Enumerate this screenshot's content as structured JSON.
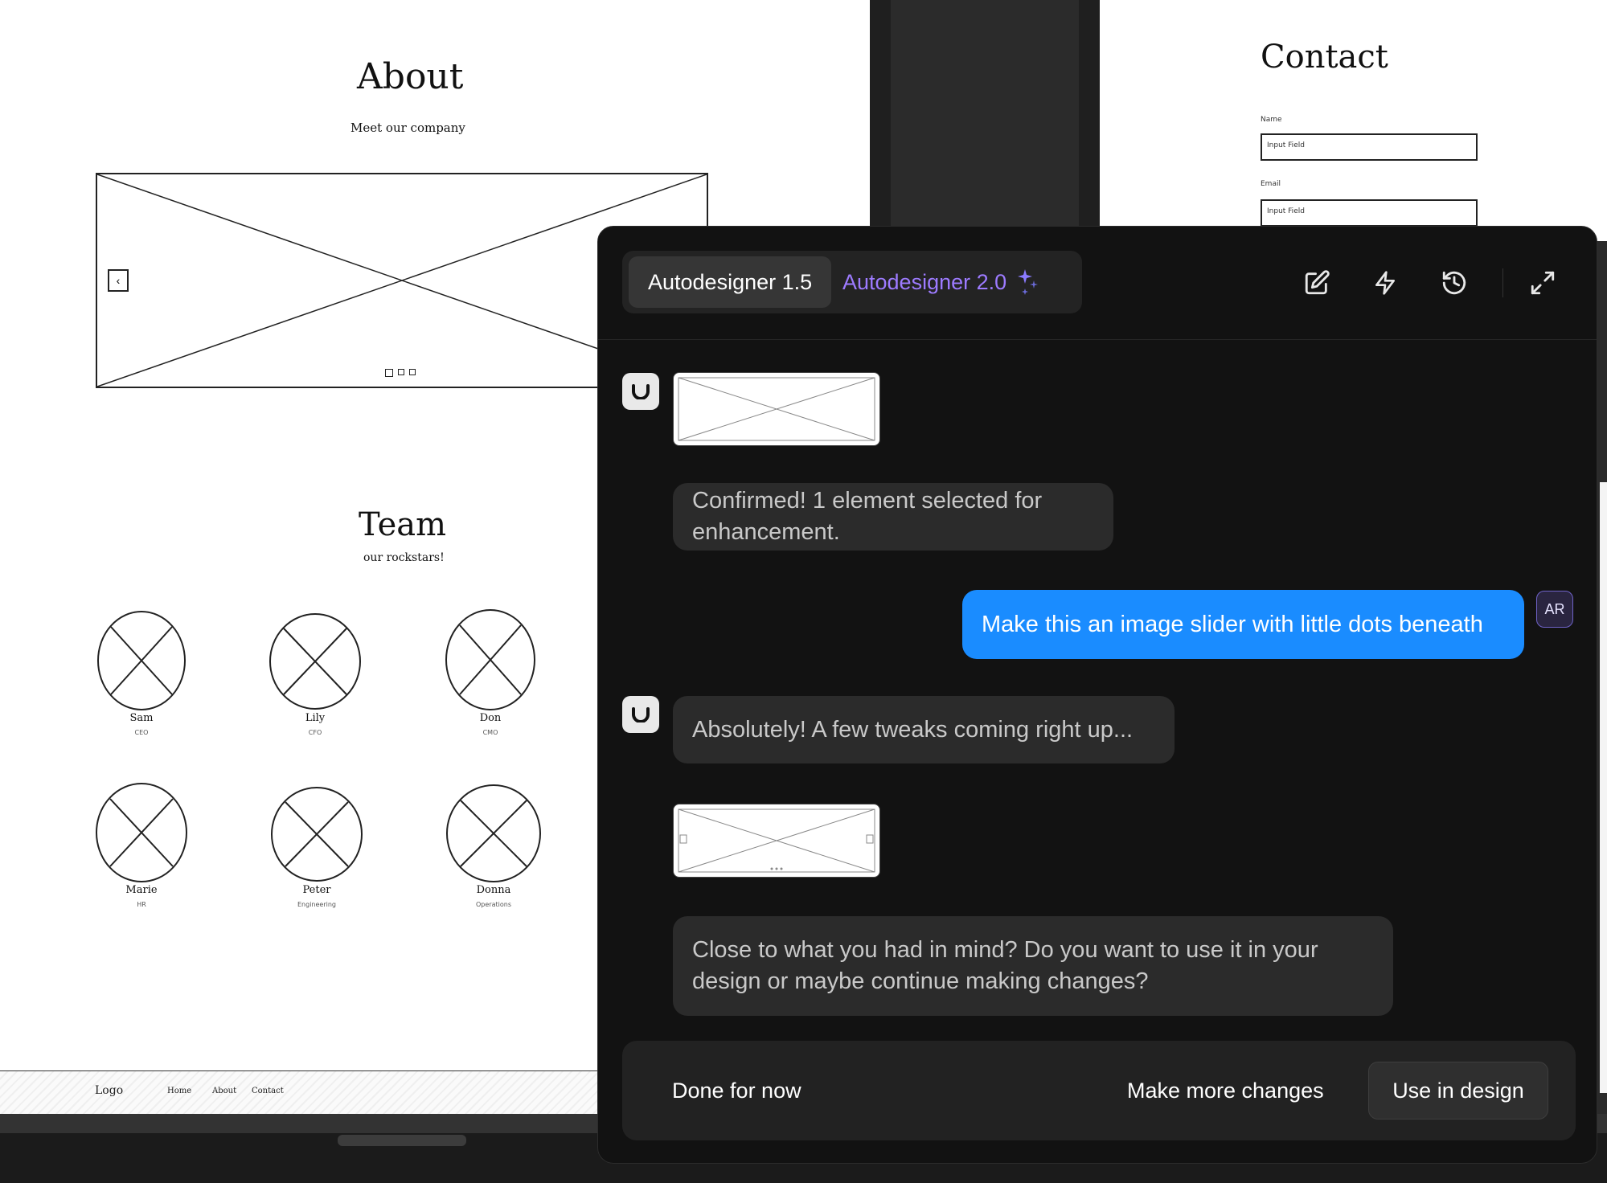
{
  "wireframe": {
    "about": {
      "title": "About",
      "subtitle": "Meet our company"
    },
    "team": {
      "title": "Team",
      "subtitle": "our rockstars!",
      "members": [
        {
          "name": "Sam",
          "role": "CEO"
        },
        {
          "name": "Lily",
          "role": "CFO"
        },
        {
          "name": "Don",
          "role": "CMO"
        },
        {
          "name": "Marie",
          "role": "HR"
        },
        {
          "name": "Peter",
          "role": "Engineering"
        },
        {
          "name": "Donna",
          "role": "Operations"
        }
      ]
    },
    "contact": {
      "title": "Contact",
      "name_label": "Name",
      "name_placeholder": "Input Field",
      "email_label": "Email",
      "email_placeholder": "Input Field"
    },
    "footer": {
      "logo": "Logo",
      "links": [
        "Home",
        "About",
        "Contact"
      ]
    }
  },
  "panel": {
    "tabs": [
      {
        "label": "Autodesigner 1.5",
        "active": true
      },
      {
        "label": "Autodesigner 2.0",
        "active": false,
        "accent": "#9d7bff"
      }
    ],
    "header_icons": [
      "edit-icon",
      "lightning-icon",
      "history-icon",
      "expand-icon"
    ],
    "messages": {
      "bot_1": "Confirmed! 1 element selected for enhancement.",
      "user_1": "Make this an image slider with little dots beneath",
      "bot_2": "Absolutely! A few tweaks coming right up...",
      "bot_3": "Close to what you had in mind? Do you want to use it in your design or maybe continue making changes?"
    },
    "user_avatar": "AR",
    "actions": {
      "done": "Done for now",
      "more": "Make more changes",
      "use": "Use in design"
    },
    "colors": {
      "user_bubble": "#1a8cff",
      "panel_bg": "#121212",
      "bot_bubble": "#2b2b2b"
    }
  }
}
